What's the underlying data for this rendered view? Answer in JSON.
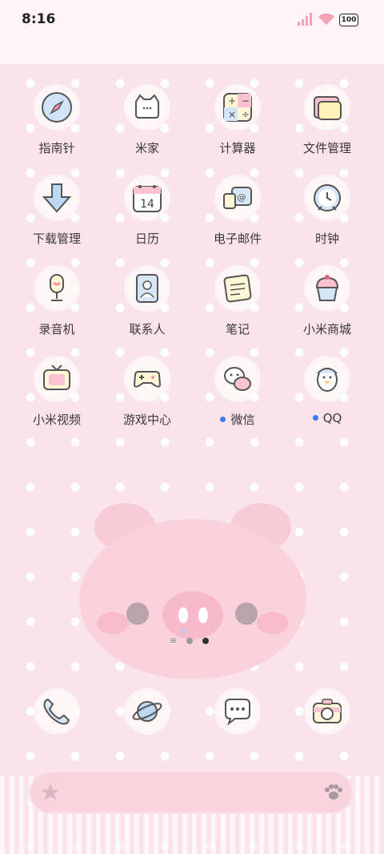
{
  "status_bar": {
    "time": "8:16",
    "battery": "100"
  },
  "apps": [
    {
      "label": "指南针",
      "icon": "compass-icon",
      "dot": false
    },
    {
      "label": "米家",
      "icon": "mijia-cat-icon",
      "dot": false
    },
    {
      "label": "计算器",
      "icon": "calculator-icon",
      "dot": false
    },
    {
      "label": "文件管理",
      "icon": "folder-icon",
      "dot": false
    },
    {
      "label": "下载管理",
      "icon": "download-arrow-icon",
      "dot": false
    },
    {
      "label": "日历",
      "icon": "calendar-icon",
      "dot": false
    },
    {
      "label": "电子邮件",
      "icon": "email-icon",
      "dot": false
    },
    {
      "label": "时钟",
      "icon": "clock-icon",
      "dot": false
    },
    {
      "label": "录音机",
      "icon": "microphone-icon",
      "dot": false
    },
    {
      "label": "联系人",
      "icon": "contacts-book-icon",
      "dot": false
    },
    {
      "label": "笔记",
      "icon": "notes-icon",
      "dot": false
    },
    {
      "label": "小米商城",
      "icon": "cupcake-icon",
      "dot": false
    },
    {
      "label": "小米视频",
      "icon": "tv-icon",
      "dot": false
    },
    {
      "label": "游戏中心",
      "icon": "gamepad-icon",
      "dot": false
    },
    {
      "label": "微信",
      "icon": "wechat-icon",
      "dot": true
    },
    {
      "label": "QQ",
      "icon": "qq-penguin-icon",
      "dot": true
    }
  ],
  "calendar_day": "14",
  "dock": [
    {
      "icon": "phone-icon"
    },
    {
      "icon": "browser-planet-icon"
    },
    {
      "icon": "messages-icon"
    },
    {
      "icon": "camera-icon"
    }
  ],
  "page_indicator": {
    "pages": 2,
    "active": 2
  },
  "colors": {
    "background": "#fbe3eb",
    "accent": "#3a7bf0",
    "search_bar": "#f9d4df"
  }
}
